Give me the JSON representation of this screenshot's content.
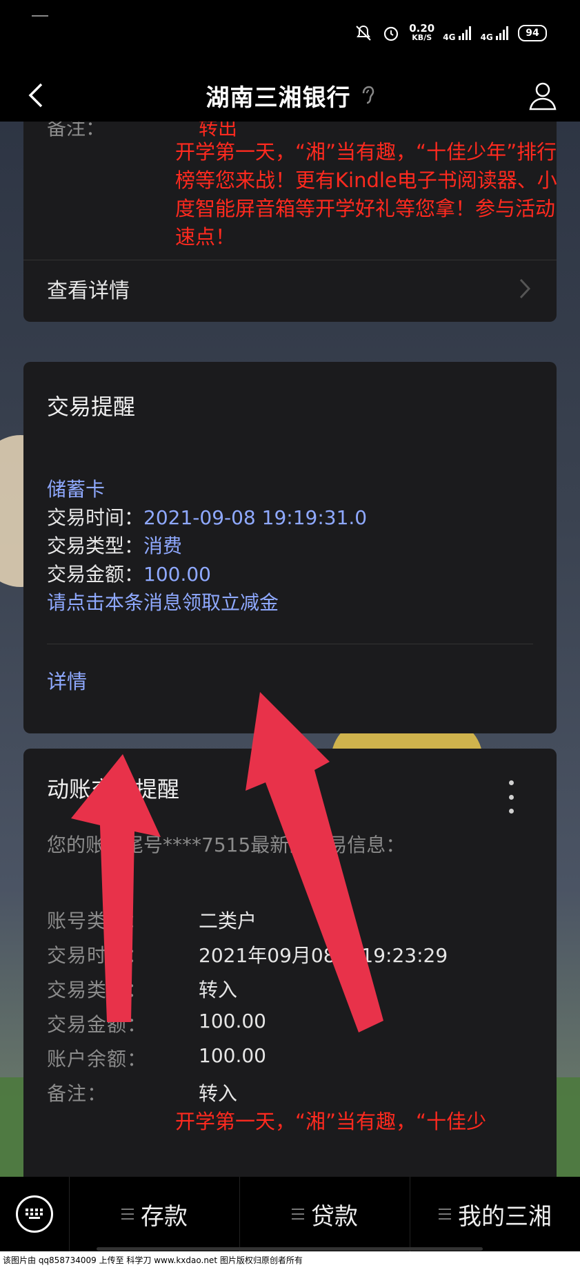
{
  "status_bar": {
    "net_speed_value": "0.20",
    "net_speed_unit": "KB/S",
    "signal_1_label": "4G",
    "signal_2_label": "4G",
    "battery": "94"
  },
  "header": {
    "title": "湖南三湘银行"
  },
  "card_prev": {
    "note_label": "备注：",
    "note_value": "转出",
    "promo": "开学第一天，“湘”当有趣，“十佳少年”排行榜等您来战！更有Kindle电子书阅读器、小度智能屏音箱等开学好礼等您拿！参与活动速点！",
    "detail_label": "查看详情"
  },
  "card_tx": {
    "title": "交易提醒",
    "card_type": "储蓄卡",
    "time_label": "交易时间：",
    "time_value": "2021-09-08 19:19:31.0",
    "type_label": "交易类型：",
    "type_value": "消费",
    "amount_label": "交易金额：",
    "amount_value": "100.00",
    "cta": "请点击本条消息领取立减金",
    "detail_link": "详情"
  },
  "card_move": {
    "title": "动账交易提醒",
    "account_line": "您的账户尾号****7515最新的交易信息：",
    "rows": [
      {
        "k": "账号类型：",
        "v": "二类户"
      },
      {
        "k": "交易时间：",
        "v": "2021年09月08日 19:23:29"
      },
      {
        "k": "交易类型：",
        "v": "转入"
      },
      {
        "k": "交易金额：",
        "v": "100.00"
      },
      {
        "k": "账户余额：",
        "v": "100.00"
      }
    ],
    "note_label": "备注：",
    "note_value": "转入",
    "promo": "开学第一天，“湘”当有趣，“十佳少"
  },
  "bottom_nav": {
    "items": [
      {
        "label": "存款"
      },
      {
        "label": "贷款"
      },
      {
        "label": "我的三湘"
      }
    ]
  },
  "watermark": "该图片由 qq858734009 上传至 科学刀 www.kxdao.net 图片版权归原创者所有",
  "colors": {
    "red_text": "#ff2a1f",
    "blue_text": "#8fa9ff",
    "arrow": "#e8324a",
    "card_bg": "#1b1b1d"
  }
}
